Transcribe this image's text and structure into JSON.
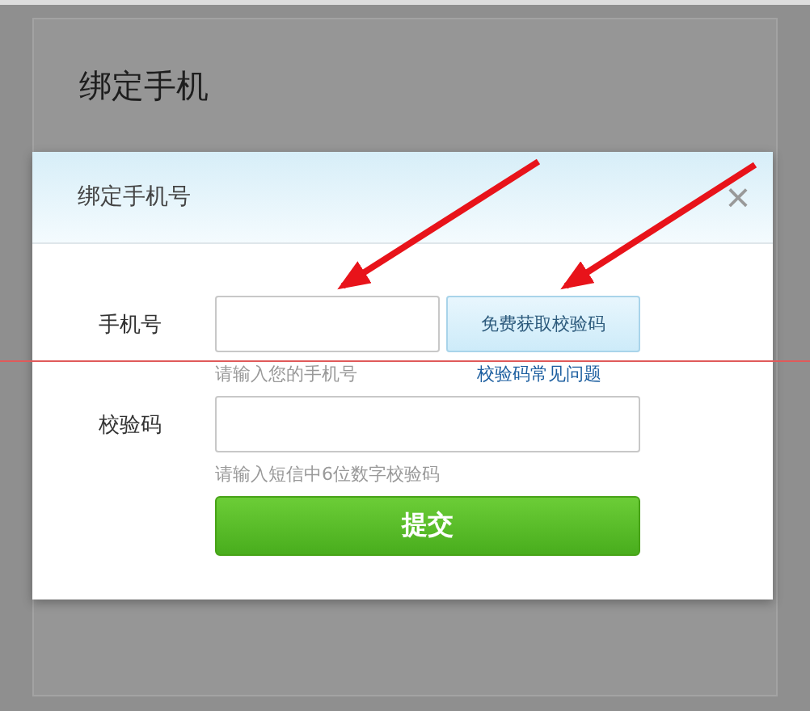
{
  "page": {
    "title": "绑定手机"
  },
  "dialog": {
    "title": "绑定手机号",
    "close": "×",
    "phone": {
      "label": "手机号",
      "hint": "请输入您的手机号",
      "send_button": "免费获取校验码",
      "help_link": "校验码常见问题"
    },
    "code": {
      "label": "校验码",
      "hint": "请输入短信中6位数字校验码"
    },
    "submit": "提交"
  }
}
